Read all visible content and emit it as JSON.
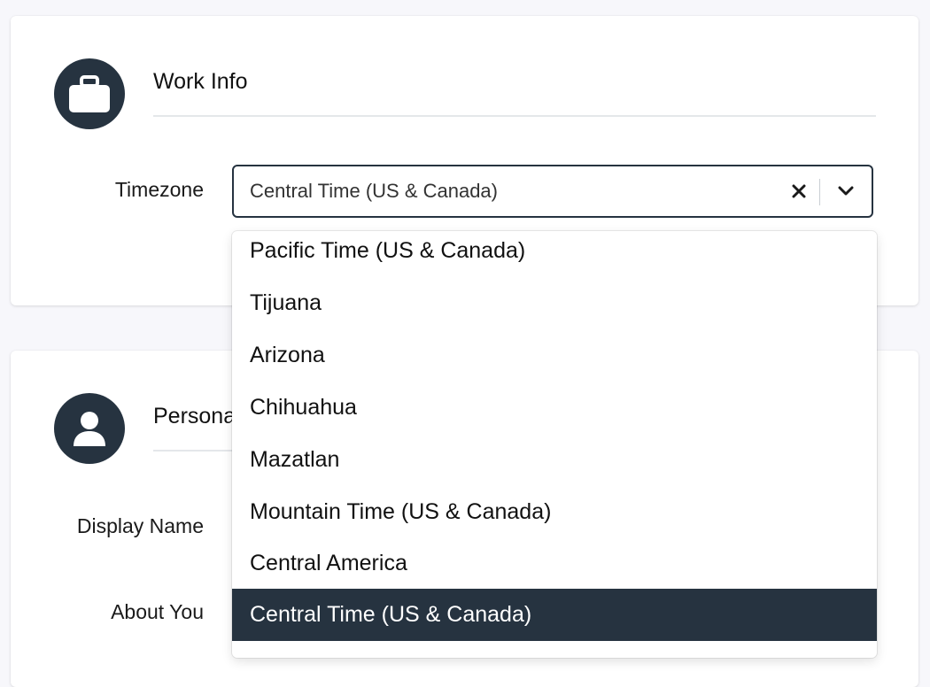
{
  "work_info": {
    "title": "Work Info",
    "icon": "briefcase-icon",
    "timezone_label": "Timezone",
    "timezone_value": "Central Time (US & Canada)"
  },
  "timezone_options": [
    "Pacific Time (US & Canada)",
    "Tijuana",
    "Arizona",
    "Chihuahua",
    "Mazatlan",
    "Mountain Time (US & Canada)",
    "Central America",
    "Central Time (US & Canada)"
  ],
  "selected_option": "Central Time (US & Canada)",
  "personal_info": {
    "title": "Persona",
    "icon": "user-icon",
    "display_name_label": "Display Name",
    "about_label": "About You"
  },
  "colors": {
    "accent": "#263340",
    "background": "#f7f7fb",
    "card": "#ffffff",
    "divider": "#e4e7ea"
  }
}
